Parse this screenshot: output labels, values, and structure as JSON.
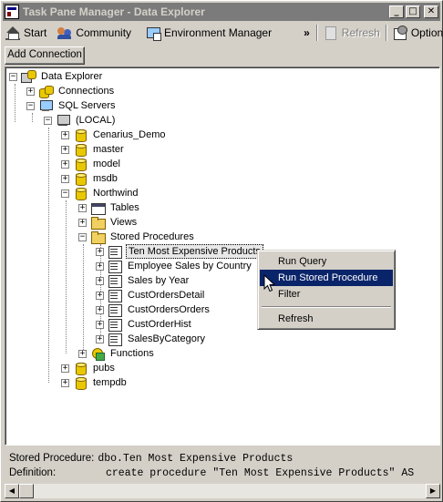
{
  "window": {
    "title": "Task Pane Manager - Data Explorer",
    "buttons": {
      "minimize": "_",
      "maximize": "□",
      "close": "✕"
    }
  },
  "toolbar": {
    "start": "Start",
    "community": "Community",
    "environment_manager": "Environment Manager",
    "overflow": "»",
    "refresh": "Refresh",
    "options": "Options"
  },
  "add_connection": "Add Connection",
  "tree": {
    "root": "Data Explorer",
    "connections": "Connections",
    "sql_servers": "SQL Servers",
    "local": "(LOCAL)",
    "databases": [
      "Cenarius_Demo",
      "master",
      "model",
      "msdb",
      "Northwind"
    ],
    "northwind": {
      "tables": "Tables",
      "views": "Views",
      "stored_procedures": "Stored Procedures",
      "procedures": [
        "Ten Most Expensive Products",
        "Employee Sales by Country",
        "Sales by Year",
        "CustOrdersDetail",
        "CustOrdersOrders",
        "CustOrderHist",
        "SalesByCategory"
      ],
      "functions": "Functions"
    },
    "more_databases": [
      "pubs",
      "tempdb"
    ],
    "expander_plus": "+",
    "expander_minus": "−"
  },
  "context_menu": {
    "items": [
      "Run Query",
      "Run Stored Procedure",
      "Filter",
      "Refresh"
    ],
    "highlighted": "Run Stored Procedure"
  },
  "info": {
    "stored_procedure_label": "Stored Procedure:",
    "stored_procedure_value": "dbo.Ten Most Expensive Products",
    "definition_label": "Definition:",
    "definition_value": "create procedure \"Ten Most Expensive Products\" AS"
  },
  "scrollbar": {
    "left_arrow": "◀",
    "right_arrow": "▶"
  },
  "colors": {
    "titlebar_inactive": "#7b7b7b",
    "menu_highlight": "#0a246a",
    "face": "#d4d0c8"
  }
}
